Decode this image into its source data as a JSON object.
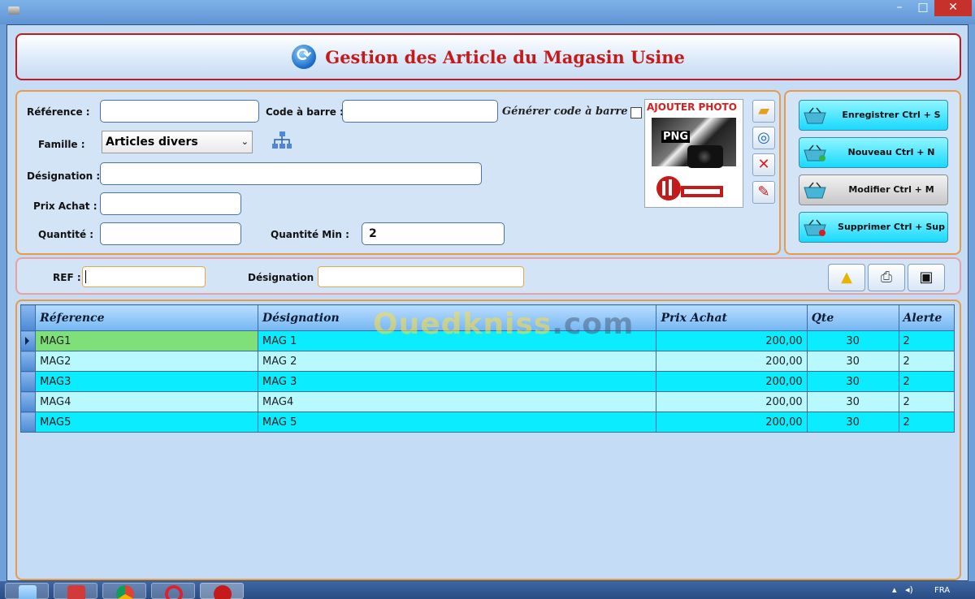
{
  "window": {
    "minimize": "–",
    "maximize": "□",
    "close": "✕"
  },
  "header": {
    "title": "Gestion des Article du Magasin Usine"
  },
  "form": {
    "reference_label": "Référence :",
    "barcode_label": "Code à barre :",
    "generate_barcode_label": "Générer code à barre",
    "family_label": "Famille :",
    "family_value": "Articles divers",
    "designation_label": "Désignation :",
    "price_label": "Prix Achat :",
    "quantity_label": "Quantité :",
    "quantity_min_label": "Quantité Min :",
    "quantity_min_value": "2",
    "photo_title": "AJOUTER PHOTO",
    "photo_png": "PNG"
  },
  "actions": {
    "save": "Enregistrer  Ctrl + S",
    "new": "Nouveau  Ctrl + N",
    "edit": "Modifier  Ctrl + M",
    "delete": "Supprimer  Ctrl + Sup"
  },
  "search": {
    "ref_label": "REF :",
    "designation_label": "Désignation :"
  },
  "watermark": {
    "part1": "Oued",
    "part2": "kniss",
    "part3": ".com"
  },
  "grid": {
    "columns": [
      "Réference",
      "Désignation",
      "Prix Achat",
      "Qte",
      "Alerte"
    ],
    "rows": [
      {
        "ref": "MAG1",
        "designation": "MAG 1",
        "price": "200,00",
        "qte": "30",
        "alert": "2"
      },
      {
        "ref": "MAG2",
        "designation": "MAG 2",
        "price": "200,00",
        "qte": "30",
        "alert": "2"
      },
      {
        "ref": "MAG3",
        "designation": "MAG 3",
        "price": "200,00",
        "qte": "30",
        "alert": "2"
      },
      {
        "ref": "MAG4",
        "designation": "MAG4",
        "price": "200,00",
        "qte": "30",
        "alert": "2"
      },
      {
        "ref": "MAG5",
        "designation": "MAG 5",
        "price": "200,00",
        "qte": "30",
        "alert": "2"
      }
    ]
  },
  "taskbar": {
    "lang": "FRA"
  }
}
